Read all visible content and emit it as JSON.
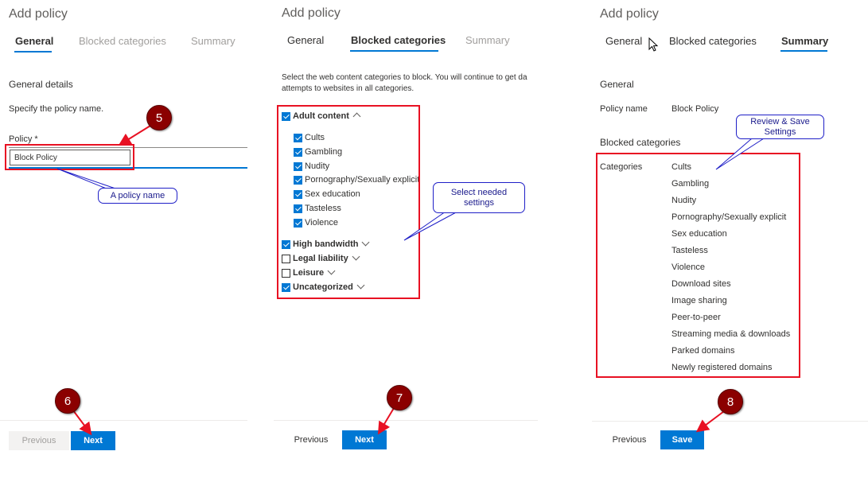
{
  "panel1": {
    "title": "Add policy",
    "tabs": [
      "General",
      "Blocked categories",
      "Summary"
    ],
    "section_heading": "General details",
    "instruction": "Specify the policy name.",
    "policy_label": "Policy *",
    "policy_value": "Block Policy",
    "prev_label": "Previous",
    "next_label": "Next"
  },
  "panel2": {
    "title": "Add policy",
    "tabs": [
      "General",
      "Blocked categories",
      "Summary"
    ],
    "instruction_line1": "Select the web content categories to block. You will continue to get da",
    "instruction_line2": "attempts to websites in all categories.",
    "groups": [
      {
        "label": "Adult content",
        "checked": true,
        "expanded": true
      },
      {
        "label": "High bandwidth",
        "checked": true,
        "expanded": false
      },
      {
        "label": "Legal liability",
        "checked": false,
        "expanded": false
      },
      {
        "label": "Leisure",
        "checked": false,
        "expanded": false
      },
      {
        "label": "Uncategorized",
        "checked": true,
        "expanded": false
      }
    ],
    "adult_items": [
      "Cults",
      "Gambling",
      "Nudity",
      "Pornography/Sexually explicit",
      "Sex education",
      "Tasteless",
      "Violence"
    ],
    "prev_label": "Previous",
    "next_label": "Next"
  },
  "panel3": {
    "title": "Add policy",
    "tabs": [
      "General",
      "Blocked categories",
      "Summary"
    ],
    "general_heading": "General",
    "policy_name_key": "Policy name",
    "policy_name_value": "Block Policy",
    "blocked_heading": "Blocked categories",
    "categories_key": "Categories",
    "categories": [
      "Cults",
      "Gambling",
      "Nudity",
      "Pornography/Sexually explicit",
      "Sex education",
      "Tasteless",
      "Violence",
      "Download sites",
      "Image sharing",
      "Peer-to-peer",
      "Streaming media & downloads",
      "Parked domains",
      "Newly registered domains"
    ],
    "prev_label": "Previous",
    "save_label": "Save"
  },
  "annotations": {
    "badges": [
      "5",
      "6",
      "7",
      "8"
    ],
    "callout_policy_name": "A policy name",
    "callout_select_line1": "Select needed",
    "callout_select_line2": "settings",
    "callout_review_line1": "Review & Save",
    "callout_review_line2": "Settings"
  },
  "colors": {
    "accent": "#0078d4",
    "highlight_box": "#e81123",
    "badge": "#8b0000",
    "callout_border": "#1f1fc7"
  }
}
